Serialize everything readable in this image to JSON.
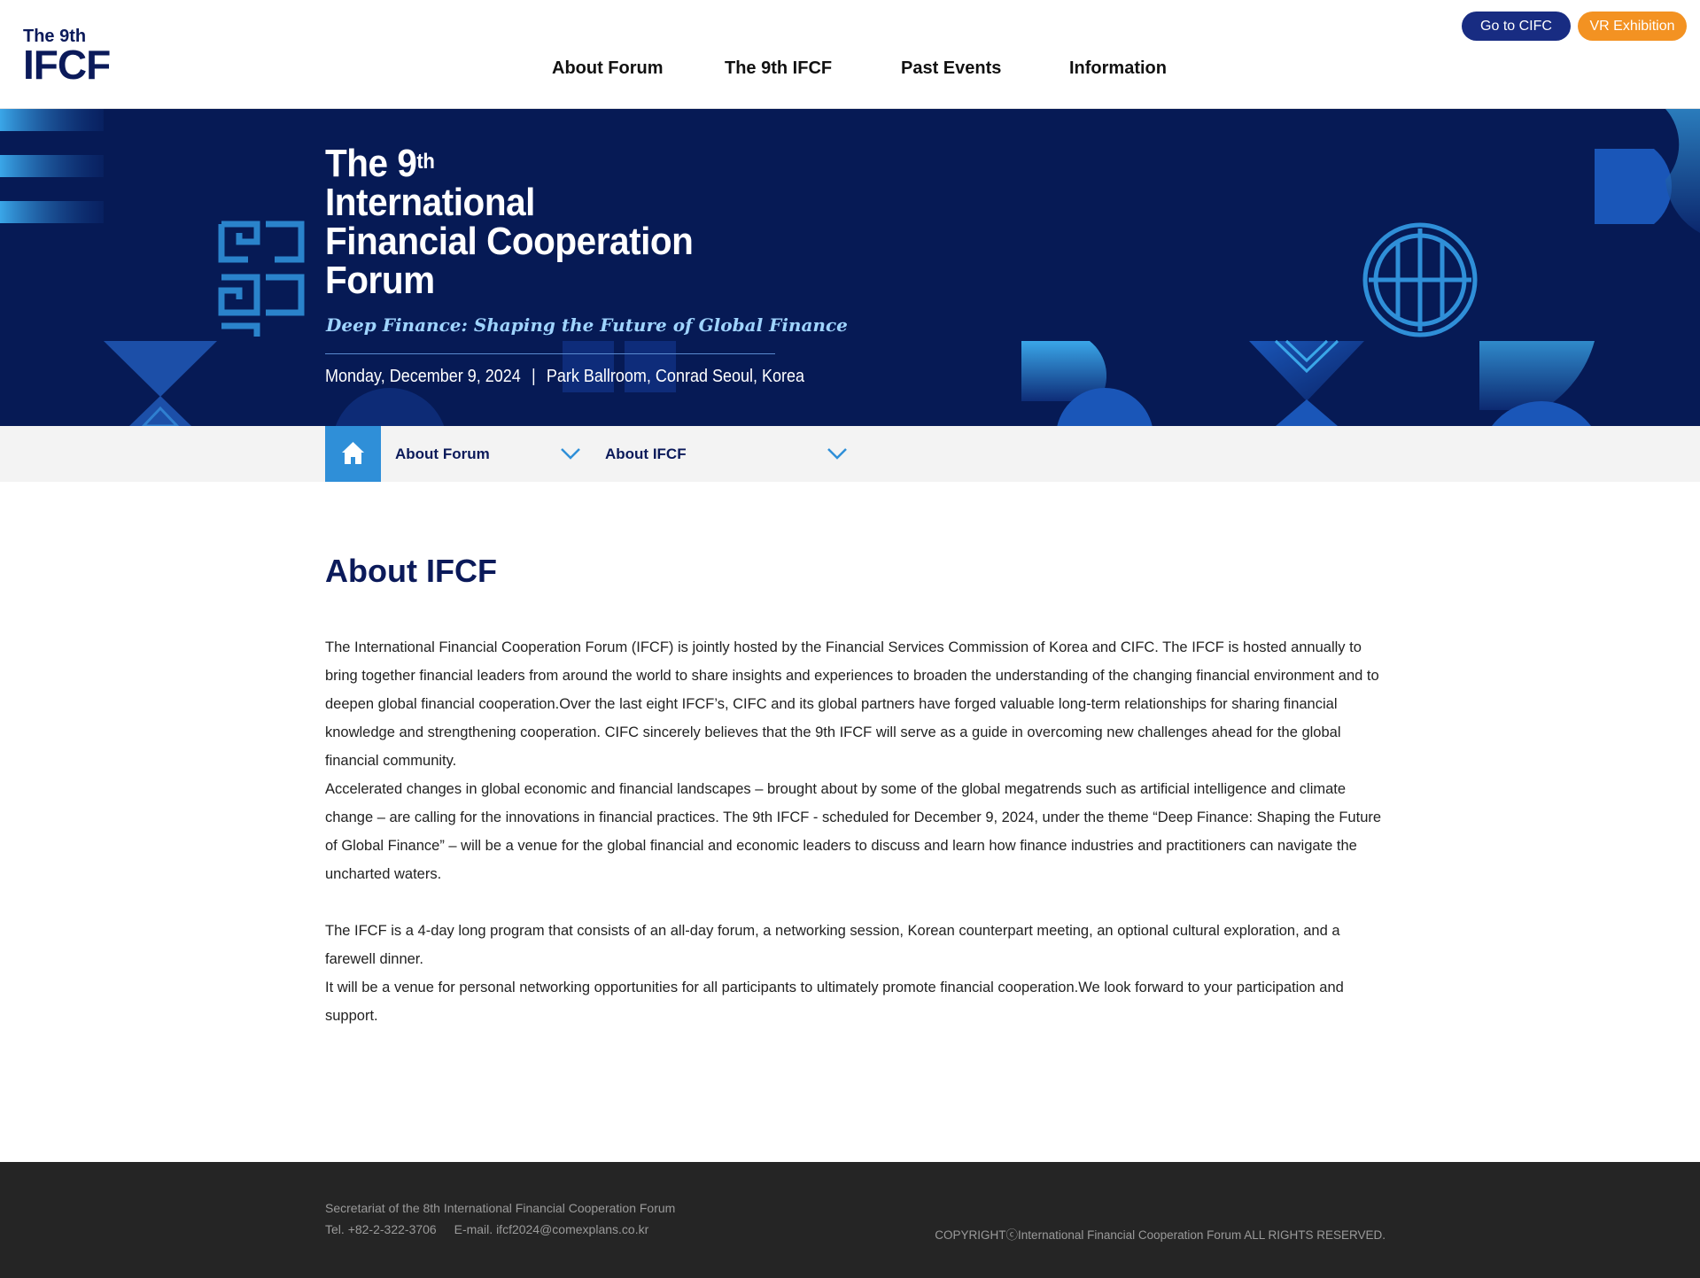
{
  "header": {
    "logo_small": "The 9th",
    "logo_big": "IFCF",
    "nav": [
      "About Forum",
      "The 9th IFCF",
      "Past Events",
      "Information"
    ],
    "btn_cifc": "Go to CIFC",
    "btn_vr": "VR Exhibition"
  },
  "hero": {
    "title_line1": "The 9",
    "title_sup": "th",
    "title_line2": "International",
    "title_line3": "Financial Cooperation",
    "title_line4": "Forum",
    "subtitle": "Deep Finance: Shaping the Future of Global Finance",
    "date": "Monday, December 9, 2024",
    "separator": "|",
    "venue": "Park Ballroom, Conrad Seoul, Korea"
  },
  "breadcrumb": {
    "level1": "About Forum",
    "level2": "About IFCF"
  },
  "content": {
    "title": "About IFCF",
    "p1": "The International Financial Cooperation Forum (IFCF) is jointly hosted by the Financial Services Commission of Korea and CIFC. The IFCF is hosted annually to bring together financial leaders from around the world to share insights and experiences to broaden the understanding of the changing financial environment and to deepen global financial cooperation.Over the last eight IFCF’s, CIFC and its global partners have forged valuable long-term relationships for sharing financial knowledge and strengthening cooperation. CIFC sincerely believes that the 9th IFCF will serve as a guide in overcoming new challenges ahead for the global financial community.",
    "p2": "Accelerated changes in global economic and financial landscapes – brought about by some of the global megatrends such as artificial intelligence and climate change – are calling for the innovations in financial practices. The 9th IFCF - scheduled for December 9, 2024, under the theme “Deep Finance: Shaping the Future of Global Finance” – will be a venue for the global financial and economic leaders to discuss and learn how finance industries and practitioners can navigate the uncharted waters.",
    "p3": "The IFCF is a 4-day long program that consists of an all-day forum, a networking session, Korean counterpart meeting, an optional cultural exploration, and a farewell dinner.",
    "p4": "It will be a venue for personal networking opportunities for all participants to ultimately promote financial cooperation.We look forward to your participation and support."
  },
  "footer": {
    "secretariat": "Secretariat of the 8th International Financial Cooperation Forum",
    "tel_label": "Tel.",
    "tel": "+82-2-322-3706",
    "email_label": "E-mail.",
    "email": "ifcf2024@comexplans.co.kr",
    "copyright": "COPYRIGHTⓒInternational Financial Cooperation Forum ALL RIGHTS RESERVED."
  },
  "colors": {
    "navy": "#0b1a5a",
    "hero_bg": "#061a55",
    "accent_blue": "#2f8fd8",
    "btn_cifc": "#182c82",
    "btn_vr": "#f39222",
    "footer_bg": "#252525"
  }
}
